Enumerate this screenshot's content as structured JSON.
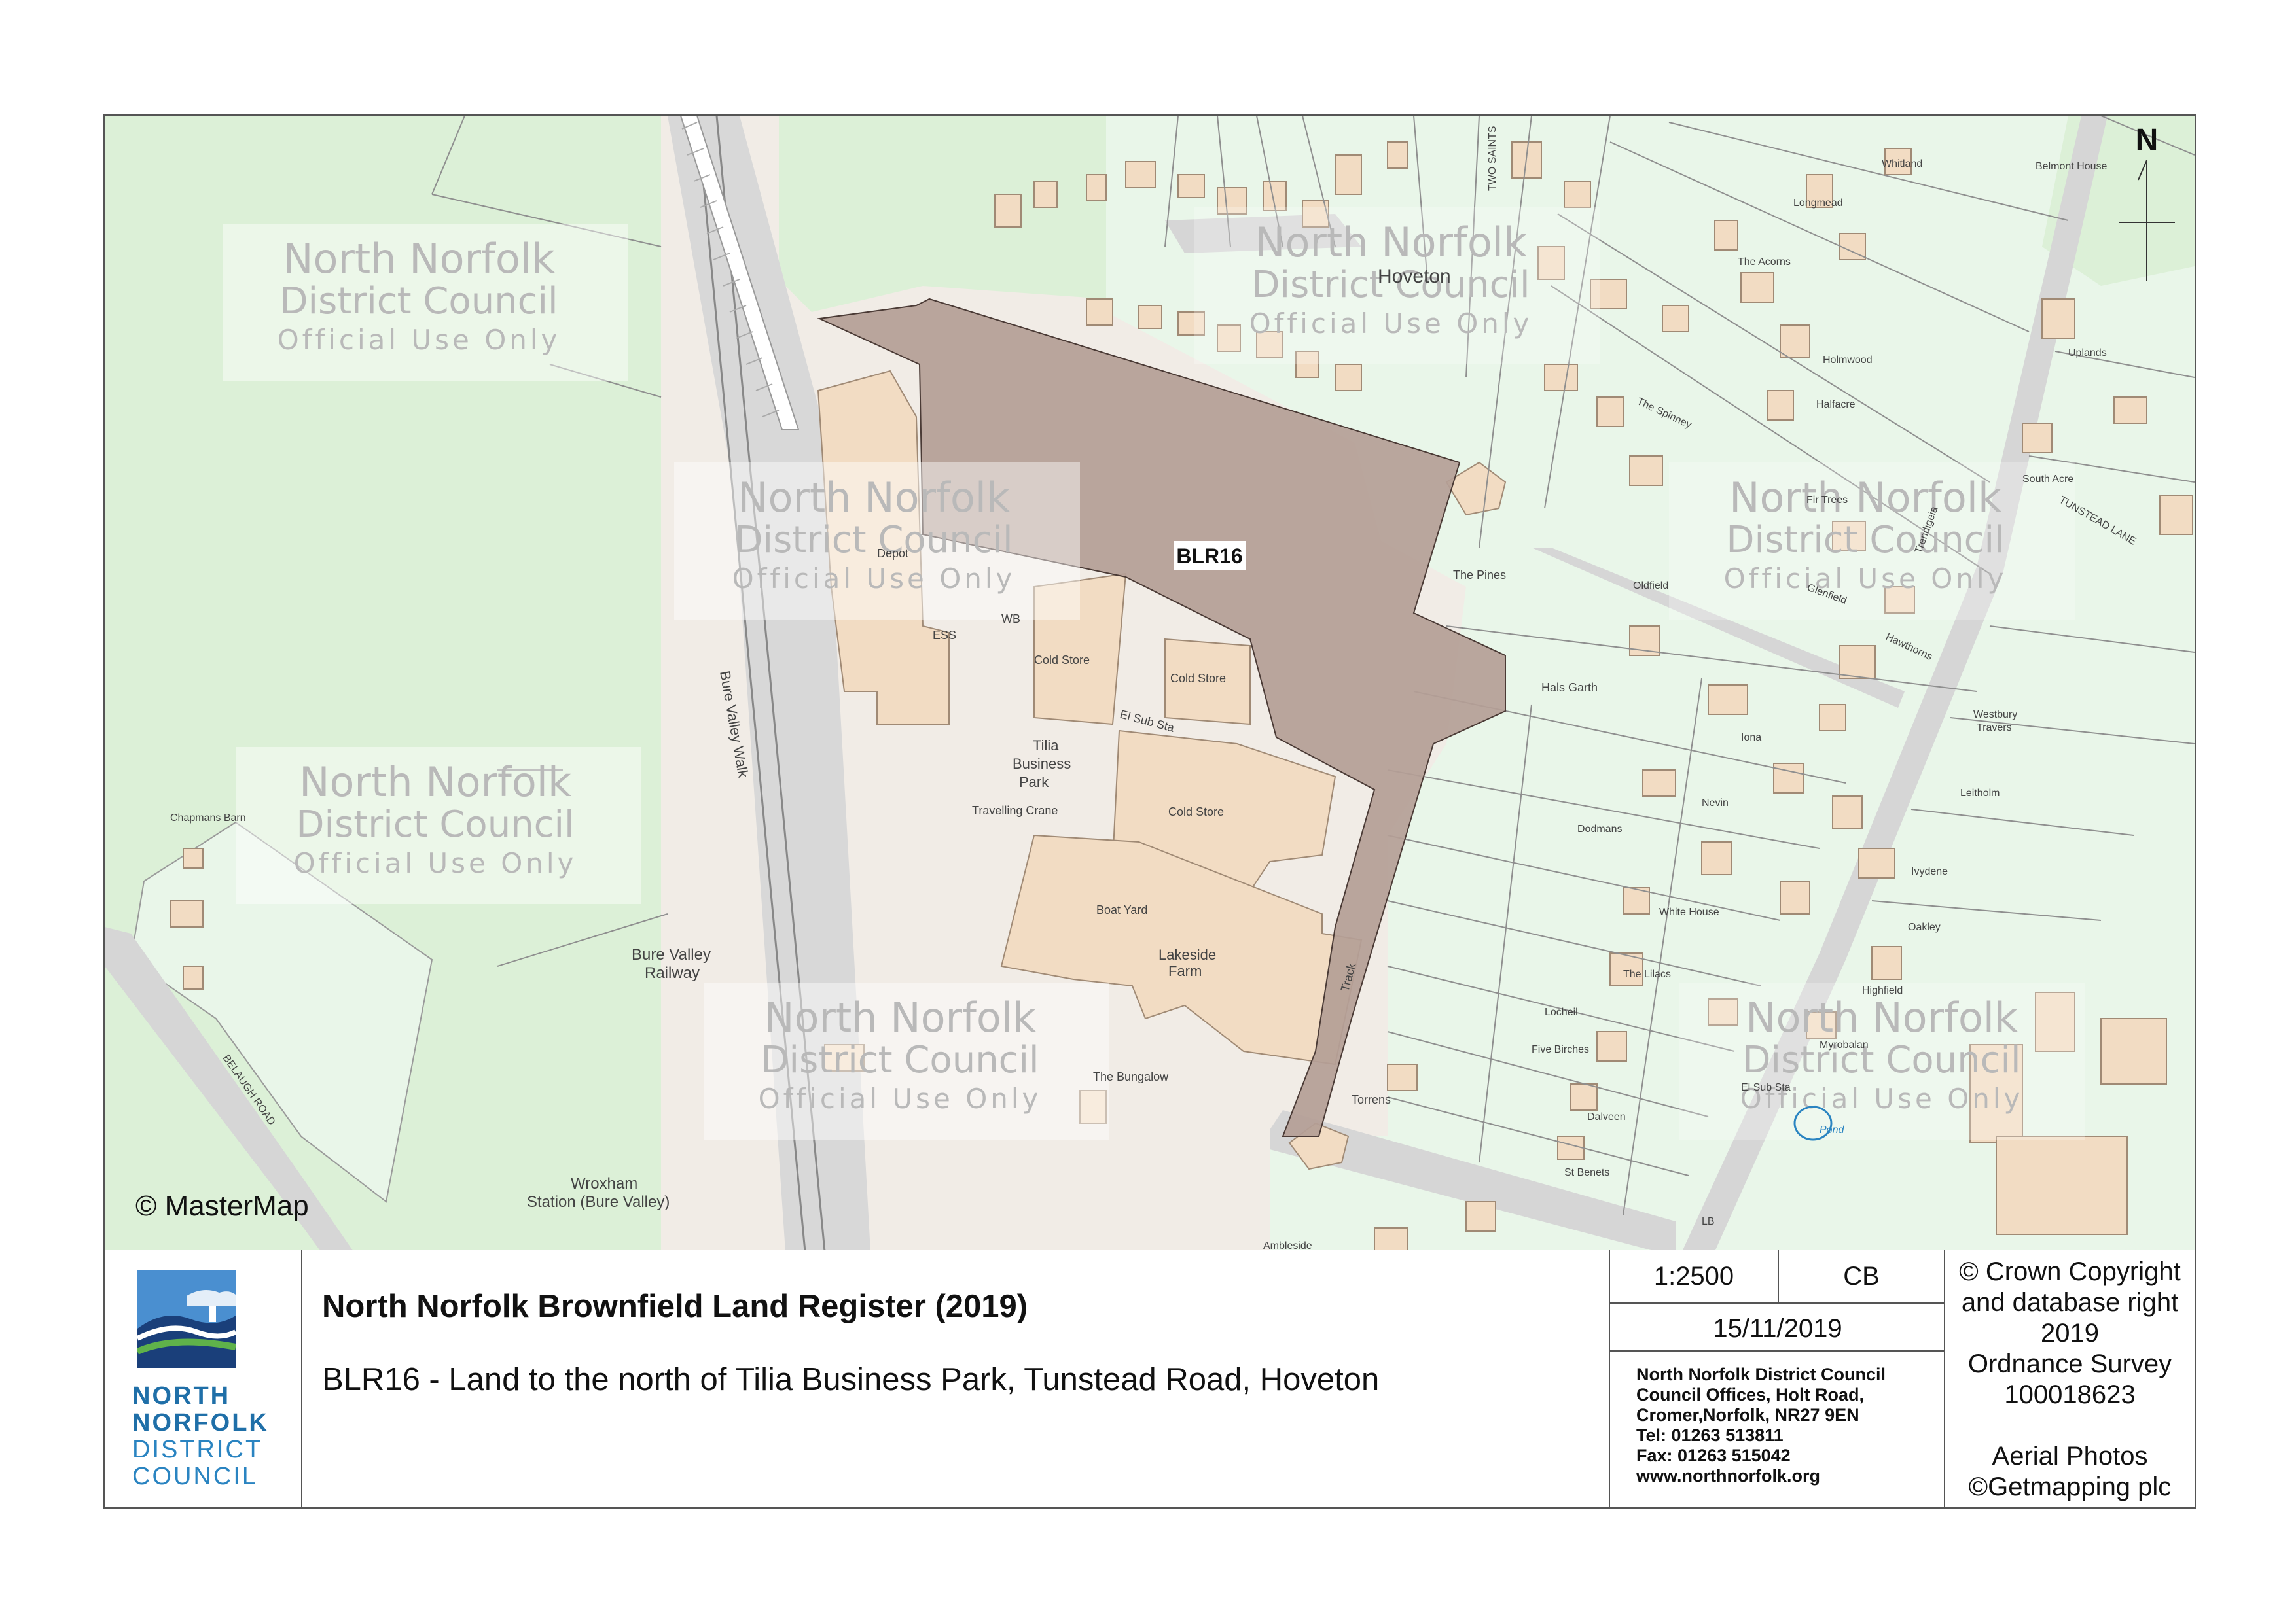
{
  "map": {
    "site_ref": "BLR16",
    "mastermap_credit": "© MasterMap",
    "north_label": "N",
    "watermark": {
      "line1": "North Norfolk",
      "line2": "District Council",
      "line3": "Official Use Only"
    },
    "labels": [
      "Depot",
      "ESS",
      "WB",
      "Cold Store",
      "Cold Store",
      "El Sub Sta",
      "Tilia",
      "Business",
      "Park",
      "Cold Store",
      "Travelling Crane",
      "Boat Yard",
      "Lakeside",
      "Farm",
      "The Bungalow",
      "Bure Valley",
      "Railway",
      "Wroxham",
      "Station (Bure Valley)",
      "Bure Valley Walk",
      "Chapmans Barn",
      "BELAUGH ROAD",
      "Hoveton",
      "TWO SAINTS",
      "Whitland",
      "Longmead",
      "The Acorns",
      "Belmont House",
      "Uplands",
      "Holmwood",
      "Halfacre",
      "The Spinney",
      "Fir Trees",
      "South Acre",
      "TUNSTEAD LANE",
      "The Pines",
      "Oldfield",
      "Glenfield",
      "Hals Garth",
      "Iona",
      "Hawthorns",
      "Westbury",
      "Travers",
      "Nevin",
      "Leitholm",
      "Dodmans",
      "Ivydene",
      "White House",
      "Oakley",
      "The Lilacs",
      "Highfield",
      "Locheil",
      "Five Birches",
      "Myrobalan",
      "Torrens",
      "El Sub Sta",
      "Dalveen",
      "Pond",
      "St Benets",
      "LB",
      "Track",
      "Ambleside",
      "Trendigeia"
    ]
  },
  "footer": {
    "logo_text": [
      "NORTH",
      "NORFOLK",
      "DISTRICT",
      "COUNCIL"
    ],
    "title": "North Norfolk Brownfield Land Register (2019)",
    "subtitle": "BLR16 - Land to the north of Tilia Business Park, Tunstead Road, Hoveton",
    "scale": "1:2500",
    "initials": "CB",
    "date": "15/11/2019",
    "address": [
      "North Norfolk District Council",
      "Council Offices, Holt Road,",
      "Cromer,Norfolk, NR27 9EN",
      "Tel: 01263 513811",
      "Fax: 01263 515042",
      "www.northnorfolk.org"
    ],
    "copyright": [
      "© Crown Copyright",
      "and database right",
      "2019",
      "Ordnance Survey",
      "100018623",
      "",
      "Aerial Photos",
      "©Getmapping plc"
    ]
  },
  "colors": {
    "site_fill": "#b49e96",
    "building": "#f2dcc3",
    "green_space": "#dcf0d7",
    "garden": "#e9f6e9",
    "road": "#d6d6d6",
    "logo_blue": "#1f6fa8"
  }
}
